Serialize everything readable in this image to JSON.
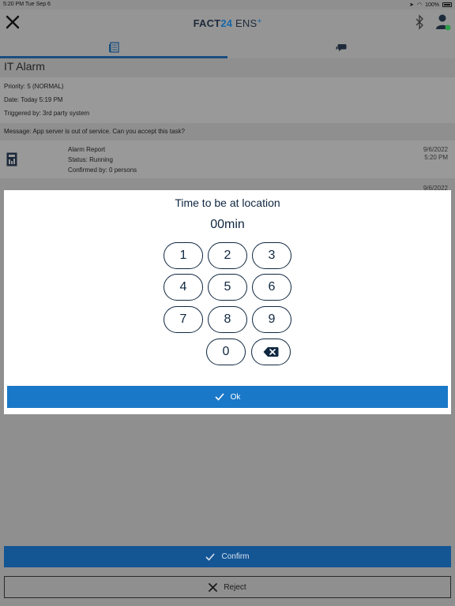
{
  "status_bar": {
    "time_date": "5:20 PM   Tue Sep 6",
    "battery": "100%"
  },
  "app": {
    "brand_prefix": "FACT",
    "brand_24": "24",
    "brand_ens": " ENS",
    "brand_plus": "+"
  },
  "alarm": {
    "title": "IT Alarm",
    "priority": "Priority: 5 (NORMAL)",
    "date": "Date: Today 5:19 PM",
    "triggered_by": "Triggered by: 3rd party system",
    "message": "Message: App server is out of service. Can you accept this task?"
  },
  "report": {
    "name": "Alarm Report",
    "status": "Status: Running",
    "confirmed": "Confirmed by: 0 persons",
    "date": "9/6/2022",
    "time": "5:20 PM",
    "next_date": "9/6/2022"
  },
  "modal": {
    "title": "Time to be at location",
    "value": "00min",
    "keys": [
      "1",
      "2",
      "3",
      "4",
      "5",
      "6",
      "7",
      "8",
      "9",
      "0"
    ],
    "ok_label": "Ok"
  },
  "actions": {
    "confirm_label": "Confirm",
    "reject_label": "Reject"
  },
  "colors": {
    "primary": "#1a78c8",
    "dark_primary": "#145594",
    "navy": "#0f2740"
  }
}
